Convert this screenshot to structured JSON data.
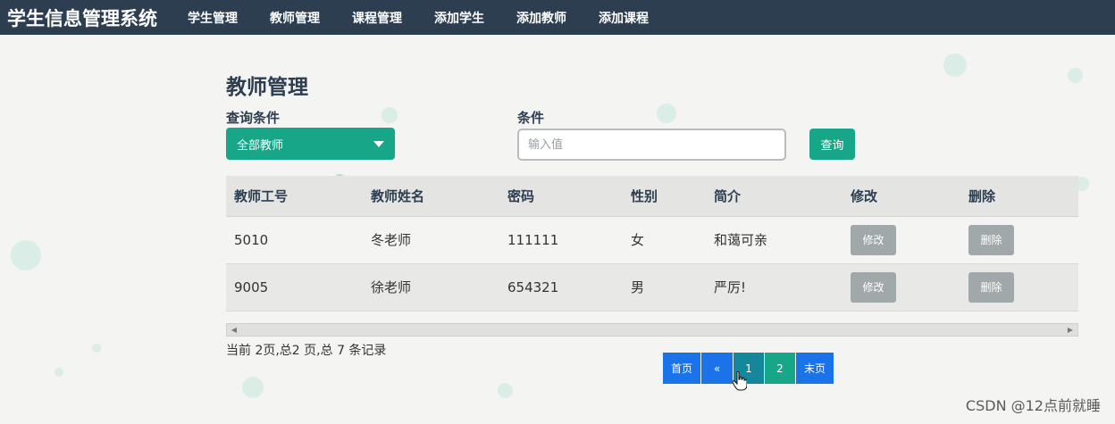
{
  "navbar": {
    "brand": "学生信息管理系统",
    "items": [
      "学生管理",
      "教师管理",
      "课程管理",
      "添加学生",
      "添加教师",
      "添加课程"
    ]
  },
  "page": {
    "title": "教师管理",
    "query_label": "查询条件",
    "condition_label": "条件",
    "select_value": "全部教师",
    "input_placeholder": "输入值",
    "query_button": "查询"
  },
  "table": {
    "headers": [
      "教师工号",
      "教师姓名",
      "密码",
      "性别",
      "简介",
      "修改",
      "删除"
    ],
    "rows": [
      {
        "id": "5010",
        "name": "冬老师",
        "password": "111111",
        "gender": "女",
        "intro": "和蔼可亲",
        "edit": "修改",
        "delete": "删除"
      },
      {
        "id": "9005",
        "name": "徐老师",
        "password": "654321",
        "gender": "男",
        "intro": "严厉!",
        "edit": "修改",
        "delete": "删除"
      }
    ]
  },
  "pagination": {
    "info": "当前 2页,总2 页,总 7 条记录",
    "first": "首页",
    "prev": "«",
    "page1": "1",
    "page2": "2",
    "last": "末页"
  },
  "watermark": "CSDN @12点前就睡",
  "colors": {
    "navbar": "#2c3e50",
    "primary": "#18a689",
    "pagination_blue": "#1a73e8",
    "button_gray": "#a1a8a9"
  }
}
